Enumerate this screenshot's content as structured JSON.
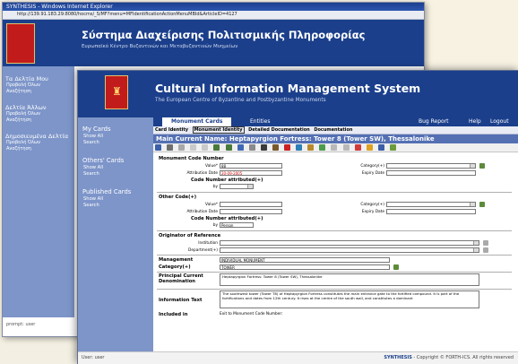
{
  "back_window": {
    "title_bar": "SYNTHESIS - Windows Internet Explorer",
    "address": "http://139.91.183.29:8080/hocms/_S/MF?menu=MFIdentificationActionMenuMBId&ArticleID=4127",
    "title": "Σύστημα Διαχείρισης Πολιτισμικής Πληροφορίας",
    "subtitle": "Ευρωπαϊκό Κέντρο Βυζαντινών και Μεταβυζαντινών Μνημείων",
    "sidebar": [
      {
        "heading": "Τα Δελτία Μου",
        "links": [
          "Προβολή Όλων",
          "Αναζήτηση"
        ]
      },
      {
        "heading": "Δελτία Άλλων",
        "links": [
          "Προβολή Όλων",
          "Αναζήτηση"
        ]
      },
      {
        "heading": "Δημοσιευμένα Δελτία",
        "links": [
          "Προβολή Όλων",
          "Αναζήτηση"
        ]
      }
    ],
    "status": "prompt: user"
  },
  "header": {
    "title": "Cultural Information Management System",
    "subtitle": "The European Centre of Byzantine and Postbyzantine Monuments"
  },
  "sidebar": [
    {
      "heading": "My Cards",
      "links": [
        "Show All",
        "Search"
      ]
    },
    {
      "heading": "Others' Cards",
      "links": [
        "Show All",
        "Search"
      ]
    },
    {
      "heading": "Published Cards",
      "links": [
        "Show All",
        "Search"
      ]
    }
  ],
  "menu": {
    "tabs": [
      "Monument Cards",
      "Entities"
    ],
    "right": [
      "Bug Report",
      "Help",
      "Logout"
    ]
  },
  "sub_tabs": [
    "Card Identity",
    "Monument Identity",
    "Detailed Documentation",
    "Documentation"
  ],
  "main_title": "Main Current Name: Heptapyrgion Fortress: Tower 8 (Tower SW), Thessalonike",
  "form": {
    "monument_code_number": {
      "heading": "Monument Code Number",
      "value_label": "Value*",
      "value": "88",
      "category_label": "Category(+)",
      "attribution_date_label": "Attribution Date",
      "attribution_date": "20-09-2005",
      "expiry_date_label": "Expiry Date",
      "attributed_heading": "Code Number attributed(+)",
      "by_label": "by"
    },
    "other_code": {
      "heading": "Other Code(+)",
      "value_label": "Value*",
      "category_label": "Category(+)",
      "attribution_date_label": "Attribution Date",
      "expiry_date_label": "Expiry Date",
      "attributed_heading": "Code Number attributed(+)",
      "by_label": "by",
      "by_value": "Person"
    },
    "originator": {
      "heading": "Originator of Reference",
      "institution_label": "Institution",
      "department_label": "Department(+)"
    },
    "management_label": "Management",
    "management_value": "INDIVIDUAL MONUMENT",
    "category_label": "Category(+)",
    "category_value": "TOWER",
    "principal_label": "Principal Current Denomination",
    "principal_value": "Heptapyrgion Fortress: Tower 8 (Tower SW), Thessalonike",
    "info_label": "Information Text",
    "info_text": "The southwest tower (Tower T8) of Heptapyrgion Fortress constitutes the main entrance gate to the fortified compound. It is part of the fortifications and dates from 12th century. It rises at the centre of the south wall, and constitutes a dominant",
    "included_label": "Included in",
    "included_note": "Exit to Monument Code Number:"
  },
  "status_bar": {
    "left": "User: user",
    "brand": "SYNTHESIS",
    "right": " - Copyright © FORTH-ICS. All rights reserved"
  },
  "colors": {
    "header_blue": "#1b3f8b",
    "sidebar_blue": "#7d95c9",
    "title_bar_blue": "#5470b3",
    "logo_red": "#c21b1b"
  },
  "icons": [
    "logo-icon",
    "save-icon",
    "print-icon",
    "undo-icon",
    "redo-icon",
    "search-icon",
    "delete-icon",
    "copy-icon",
    "help-icon"
  ]
}
